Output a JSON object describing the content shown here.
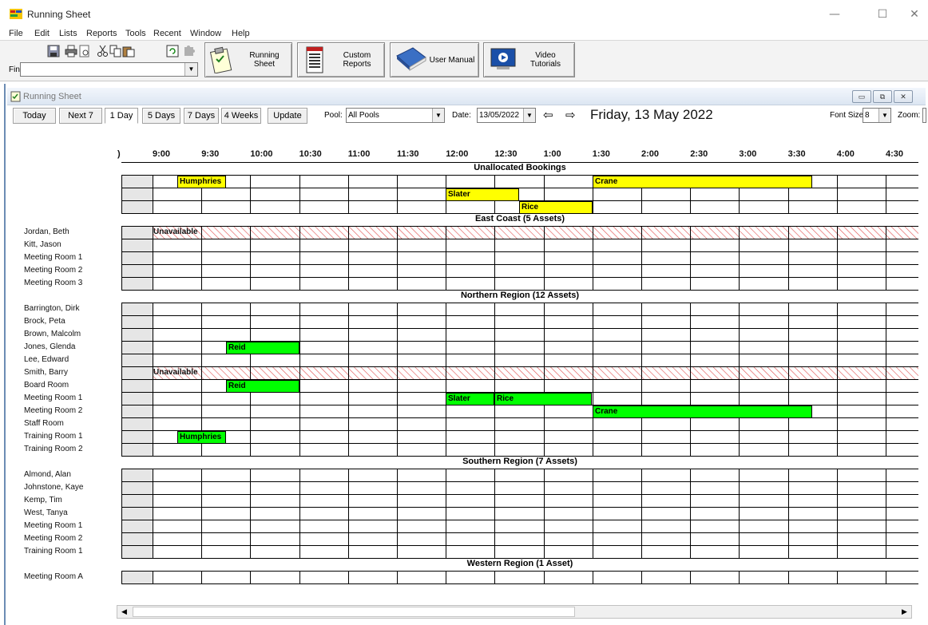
{
  "window": {
    "title": "Running Sheet",
    "controls": {
      "minimize": "—",
      "maximize": "☐",
      "close": "✕"
    }
  },
  "menu": [
    "File",
    "Edit",
    "Lists",
    "Reports",
    "Tools",
    "Recent",
    "Window",
    "Help"
  ],
  "toolbar": {
    "find_label": "Find:",
    "find_value": "",
    "buttons": [
      {
        "name": "running-sheet",
        "label1": "Running",
        "label2": "Sheet"
      },
      {
        "name": "custom-reports",
        "label1": "Custom",
        "label2": "Reports"
      },
      {
        "name": "user-manual",
        "label1": "User Manual",
        "label2": ""
      },
      {
        "name": "video-tutorials",
        "label1": "Video",
        "label2": "Tutorials"
      }
    ]
  },
  "child_window": {
    "title": "Running Sheet"
  },
  "sheet_toolbar": {
    "nav_buttons": [
      "Today",
      "Next 7",
      "1 Day",
      "5 Days",
      "7 Days",
      "4 Weeks",
      "Update"
    ],
    "selected": "1 Day",
    "pool_label": "Pool:",
    "pool_value": "All Pools",
    "date_label": "Date:",
    "date_value": "13/05/2022",
    "prev_arrow": "⇦",
    "next_arrow": "⇨",
    "date_heading": "Friday, 13 May 2022",
    "font_size_label": "Font Size:",
    "font_size_value": "8",
    "zoom_label": "Zoom:"
  },
  "schedule": {
    "times": [
      ")",
      "9:00",
      "9:30",
      "10:00",
      "10:30",
      "11:00",
      "11:30",
      "12:00",
      "12:30",
      "1:00",
      "1:30",
      "2:00",
      "2:30",
      "3:00",
      "3:30",
      "4:00",
      "4:30"
    ],
    "unavailable_label": "Unavailable",
    "colors": {
      "yellow": "#ffff00",
      "green": "#00ff00",
      "unavailable_hatch": "#e05050"
    },
    "sections": [
      {
        "title": "Unallocated Bookings",
        "rows": [
          {
            "label": "",
            "bookings": [
              {
                "name": "Humphries",
                "start": "9:15",
                "end": "9:45",
                "color": "yellow"
              },
              {
                "name": "Crane",
                "start": "1:30",
                "end": "3:45",
                "color": "yellow"
              }
            ]
          },
          {
            "label": "",
            "bookings": [
              {
                "name": "Slater",
                "start": "12:00",
                "end": "12:45",
                "color": "yellow"
              }
            ]
          },
          {
            "label": "",
            "bookings": [
              {
                "name": "Rice",
                "start": "12:45",
                "end": "1:30",
                "color": "yellow"
              }
            ]
          }
        ]
      },
      {
        "title": "East Coast (5 Assets)",
        "rows": [
          {
            "label": "Jordan, Beth",
            "unavailable": true,
            "bookings": []
          },
          {
            "label": "Kitt, Jason",
            "bookings": []
          },
          {
            "label": "Meeting Room 1",
            "bookings": []
          },
          {
            "label": "Meeting Room 2",
            "bookings": []
          },
          {
            "label": "Meeting Room 3",
            "bookings": []
          }
        ]
      },
      {
        "title": "Northern Region (12 Assets)",
        "rows": [
          {
            "label": "Barrington, Dirk",
            "bookings": []
          },
          {
            "label": "Brock, Peta",
            "bookings": []
          },
          {
            "label": "Brown, Malcolm",
            "bookings": []
          },
          {
            "label": "Jones, Glenda",
            "bookings": [
              {
                "name": "Reid",
                "start": "9:45",
                "end": "10:30",
                "color": "green"
              }
            ]
          },
          {
            "label": "Lee, Edward",
            "bookings": []
          },
          {
            "label": "Smith, Barry",
            "unavailable": true,
            "bookings": []
          },
          {
            "label": "Board Room",
            "bookings": [
              {
                "name": "Reid",
                "start": "9:45",
                "end": "10:30",
                "color": "green"
              }
            ]
          },
          {
            "label": "Meeting Room 1",
            "bookings": [
              {
                "name": "Slater",
                "start": "12:00",
                "end": "12:30",
                "color": "green"
              },
              {
                "name": "Rice",
                "start": "12:30",
                "end": "1:30",
                "color": "green"
              }
            ]
          },
          {
            "label": "Meeting Room 2",
            "bookings": [
              {
                "name": "Crane",
                "start": "1:30",
                "end": "3:45",
                "color": "green"
              }
            ]
          },
          {
            "label": "Staff Room",
            "bookings": []
          },
          {
            "label": "Training Room 1",
            "bookings": [
              {
                "name": "Humphries",
                "start": "9:15",
                "end": "9:45",
                "color": "green"
              }
            ]
          },
          {
            "label": "Training Room 2",
            "bookings": []
          }
        ]
      },
      {
        "title": "Southern Region (7 Assets)",
        "rows": [
          {
            "label": "Almond, Alan",
            "bookings": []
          },
          {
            "label": "Johnstone, Kaye",
            "bookings": []
          },
          {
            "label": "Kemp, Tim",
            "bookings": []
          },
          {
            "label": "West, Tanya",
            "bookings": []
          },
          {
            "label": "Meeting Room 1",
            "bookings": []
          },
          {
            "label": "Meeting Room 2",
            "bookings": []
          },
          {
            "label": "Training Room 1",
            "bookings": []
          }
        ]
      },
      {
        "title": "Western Region (1 Asset)",
        "rows": [
          {
            "label": "Meeting Room A",
            "bookings": []
          }
        ]
      }
    ]
  },
  "scrollbar": {
    "left_arrow": "◀",
    "right_arrow": "▶"
  }
}
